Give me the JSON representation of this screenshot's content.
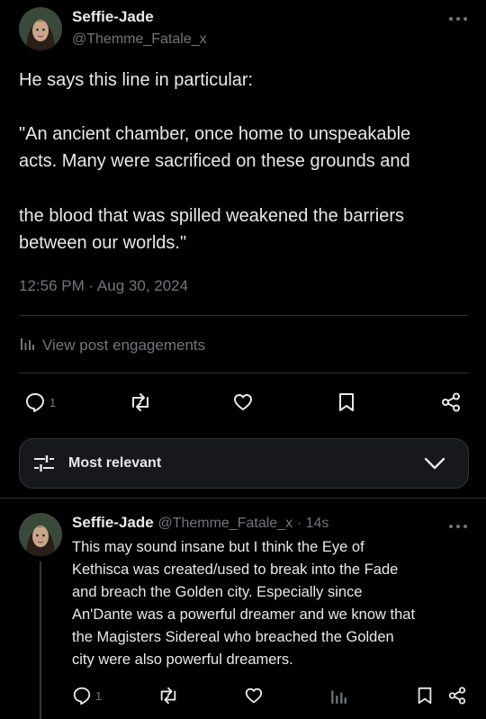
{
  "post": {
    "author_name": "Seffie-Jade",
    "author_handle": "@Themme_Fatale_x",
    "lines": [
      "He says this line in particular:",
      "",
      "\"An ancient chamber, once home to unspeakable",
      "acts. Many were sacrificed on these grounds and",
      "",
      "the blood that was spilled weakened the barriers",
      "between our worlds.\""
    ],
    "timestamp": "12:56 PM · Aug 30, 2024",
    "engagements_label": "View post engagements",
    "reply_count": "1"
  },
  "filter": {
    "label": "Most relevant"
  },
  "reply": {
    "author_name": "Seffie-Jade",
    "author_handle": "@Themme_Fatale_x",
    "time": "· 14s",
    "lines": [
      "This may sound insane but I think the Eye of",
      "Kethisca was created/used to break into the Fade",
      "and breach the Golden city. Especially since",
      "An'Dante was a powerful dreamer and we know that",
      "the Magisters Sidereal who breached the Golden",
      "city were also powerful dreamers."
    ],
    "reply_count": "1"
  },
  "icons": {
    "more": "more-horizontal-icon",
    "reply": "reply-bubble-icon",
    "repost": "repost-icon",
    "like": "heart-icon",
    "bookmark": "bookmark-icon",
    "share": "share-icon",
    "analytics": "analytics-bars-icon",
    "filter": "sliders-icon",
    "chevron": "chevron-down-icon"
  },
  "colors": {
    "background": "#000000",
    "text": "#e7e9ea",
    "muted": "#71767b",
    "divider": "#2f3336"
  }
}
